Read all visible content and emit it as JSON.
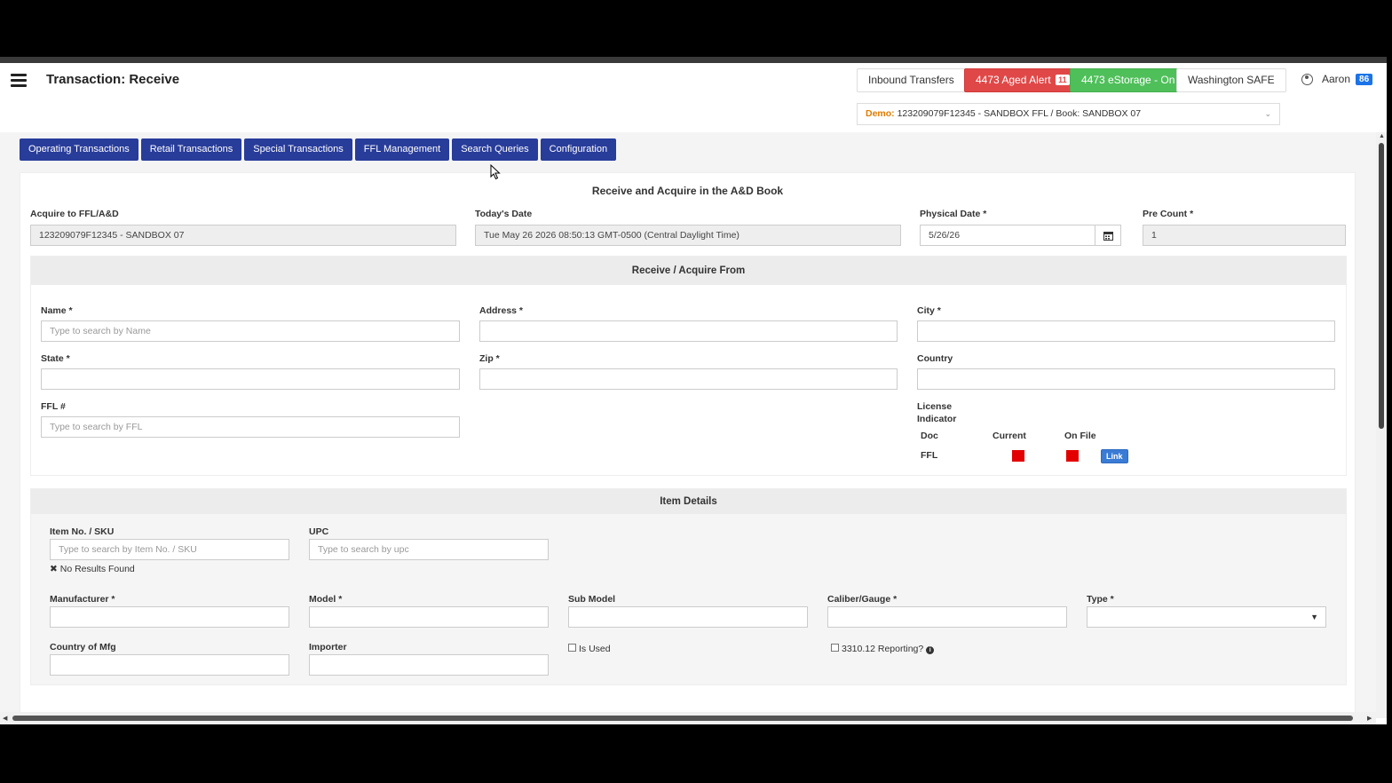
{
  "header": {
    "title": "Transaction: Receive",
    "buttons": {
      "inbound": "Inbound Transfers",
      "aged_alert": "4473 Aged Alert",
      "aged_alert_count": "11",
      "estorage": "4473 eStorage - On",
      "safe": "Washington SAFE"
    },
    "user": {
      "name": "Aaron",
      "badge": "86"
    },
    "demo_select": {
      "label": "Demo:",
      "value": "123209079F12345 - SANDBOX FFL / Book: SANDBOX 07"
    }
  },
  "tabs": [
    "Operating Transactions",
    "Retail Transactions",
    "Special Transactions",
    "FFL Management",
    "Search Queries",
    "Configuration"
  ],
  "form": {
    "title": "Receive and Acquire in the A&D Book",
    "acquire_label": "Acquire to FFL/A&D",
    "acquire_value": "123209079F12345 - SANDBOX 07",
    "today_label": "Today's Date",
    "today_value": "Tue May 26 2026 08:50:13 GMT-0500 (Central Daylight Time)",
    "physical_label": "Physical Date *",
    "physical_value": "5/26/26",
    "precount_label": "Pre Count *",
    "precount_value": "1"
  },
  "receive_from": {
    "title": "Receive / Acquire From",
    "name_label": "Name *",
    "name_placeholder": "Type to search by Name",
    "address_label": "Address *",
    "city_label": "City *",
    "state_label": "State *",
    "zip_label": "Zip *",
    "country_label": "Country",
    "ffl_label": "FFL #",
    "ffl_placeholder": "Type to search by FFL",
    "license_label_1": "License",
    "license_label_2": "Indicator",
    "col_doc": "Doc",
    "col_current": "Current",
    "col_onfile": "On File",
    "row_doc": "FFL",
    "link_label": "Link",
    "status_color": "#e30000"
  },
  "item_details": {
    "title": "Item Details",
    "sku_label": "Item No. / SKU",
    "sku_placeholder": "Type to search by Item No. / SKU",
    "no_results": "No Results Found",
    "upc_label": "UPC",
    "upc_placeholder": "Type to search by upc",
    "manufacturer_label": "Manufacturer *",
    "model_label": "Model *",
    "submodel_label": "Sub Model",
    "caliber_label": "Caliber/Gauge *",
    "type_label": "Type *",
    "country_mfg_label": "Country of Mfg",
    "importer_label": "Importer",
    "is_used_label": "Is Used",
    "reporting_label": "3310.12 Reporting?"
  }
}
